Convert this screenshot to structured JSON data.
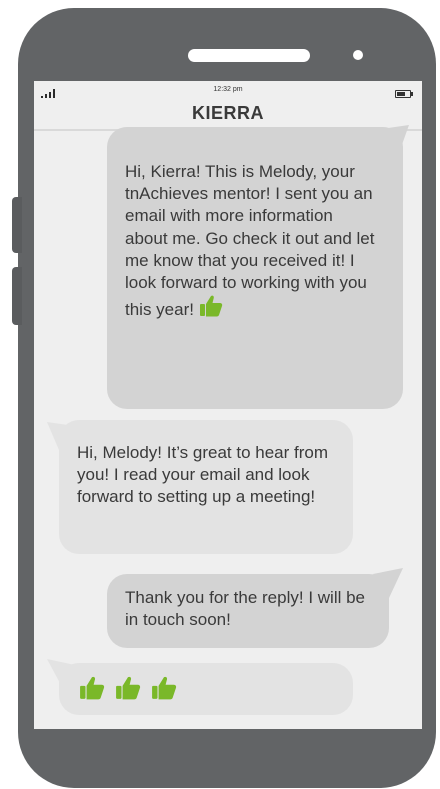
{
  "status_bar": {
    "time": "12:32 pm",
    "battery_level": 0.7
  },
  "contact_name": "KIERRA",
  "messages": [
    {
      "direction": "sent",
      "text": "Hi, Kierra! This is Melody, your tnAchieves mentor! I sent you an email with more information about me. Go check it out and let me know that you received it! I look forward to working with you this year!",
      "emoji": "thumbs-up-icon"
    },
    {
      "direction": "received",
      "text": "Hi, Melody! It’s great to hear from you! I read your email and look forward to setting up a meeting!"
    },
    {
      "direction": "sent",
      "text": "Thank you for the reply! I will be in touch soon!"
    },
    {
      "direction": "received",
      "text": "",
      "emoji_count": 3,
      "emoji": "thumbs-up-icon"
    }
  ],
  "colors": {
    "phone": "#626466",
    "screen": "#efefef",
    "sent_bubble": "#d3d3d3",
    "received_bubble": "#e3e3e3",
    "thumb": "#7ab829"
  }
}
